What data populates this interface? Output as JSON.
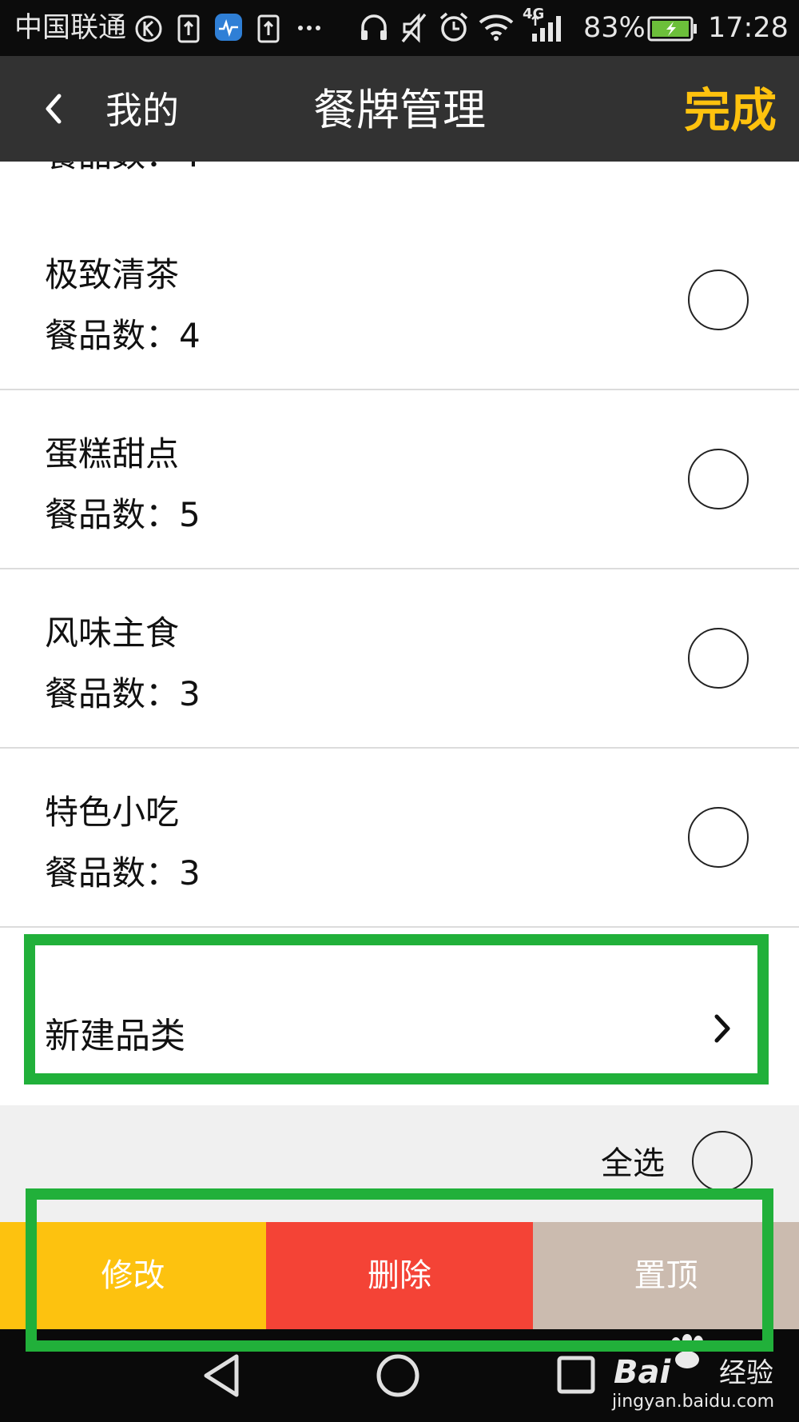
{
  "status_bar": {
    "carrier": "中国联通",
    "network": "4G",
    "battery": "83%",
    "time": "17:28",
    "icons": [
      "k-circle-icon",
      "upload-box-icon",
      "heartrate-app-icon",
      "upload-box-icon",
      "more-dots-icon",
      "headphones-icon",
      "mute-icon",
      "alarm-icon",
      "wifi-icon",
      "signal-icon",
      "battery-charging-icon"
    ]
  },
  "header": {
    "back_label": "我的",
    "title": "餐牌管理",
    "done_label": "完成"
  },
  "list": {
    "partial_row_text": "餐品数：4",
    "count_prefix": "餐品数：",
    "items": [
      {
        "name": "极致清茶",
        "count_text": "餐品数：4",
        "count": 4
      },
      {
        "name": "蛋糕甜点",
        "count_text": "餐品数：5",
        "count": 5
      },
      {
        "name": "风味主食",
        "count_text": "餐品数：3",
        "count": 3
      },
      {
        "name": "特色小吃",
        "count_text": "餐品数：3",
        "count": 3
      }
    ]
  },
  "new_category": {
    "label": "新建品类"
  },
  "select_all": {
    "label": "全选"
  },
  "actions": {
    "edit_label": "修改",
    "delete_label": "删除",
    "pin_label": "置顶"
  },
  "colors": {
    "accent": "#ffc20e",
    "edit_bg": "#fdc20f",
    "delete_bg": "#f44336",
    "pin_bg": "#cbbbaf",
    "annotation": "#21b03a"
  },
  "watermark": {
    "brand": "Bai",
    "brand_suffix": "经验",
    "url": "jingyan.baidu.com"
  }
}
